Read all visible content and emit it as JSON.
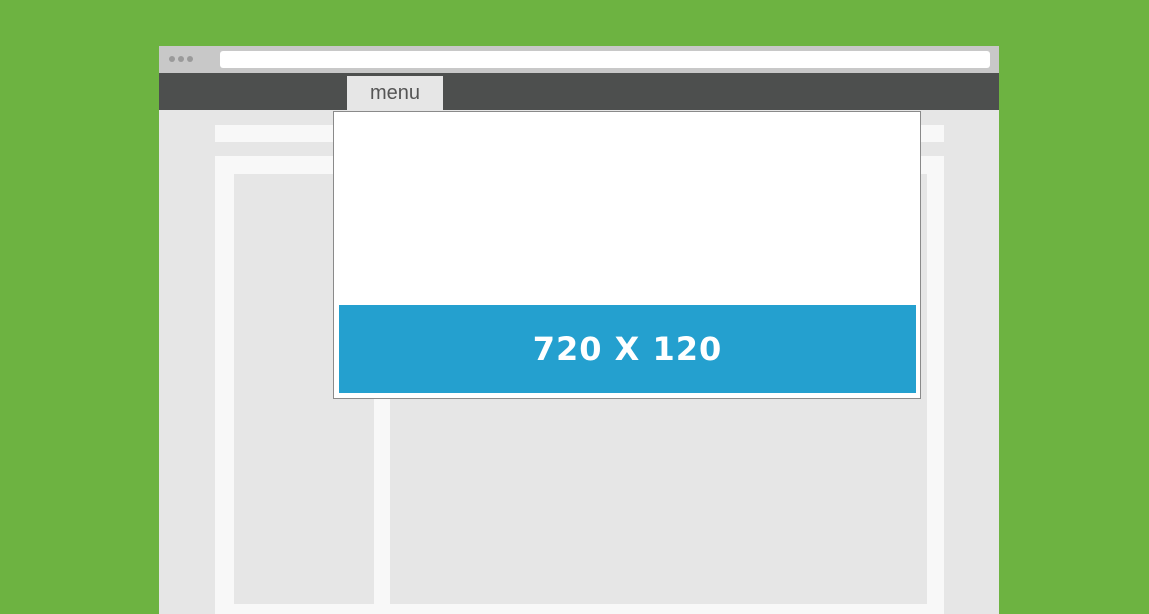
{
  "nav": {
    "menu_label": "menu"
  },
  "dropdown": {
    "ad_banner_label": "720 X 120"
  },
  "colors": {
    "background": "#6db341",
    "navbar": "#4d4f4e",
    "ad_banner": "#24a0cf"
  },
  "icons": {
    "window_controls": "three-dots-icon"
  }
}
